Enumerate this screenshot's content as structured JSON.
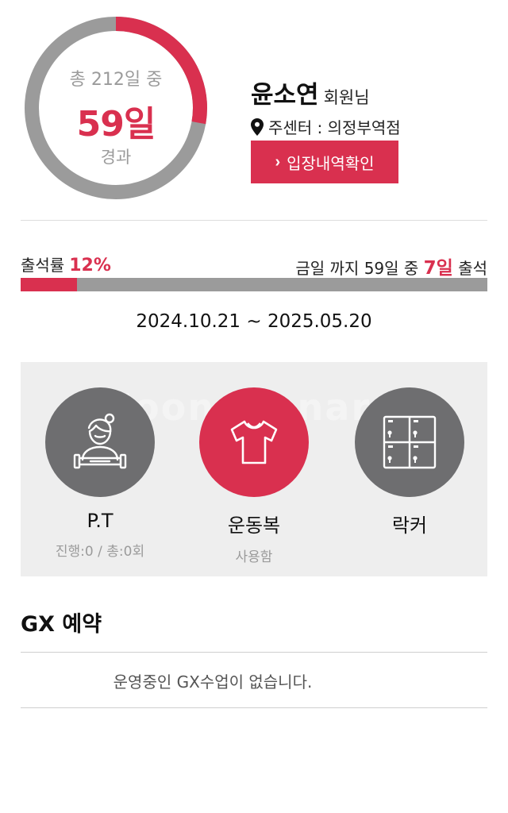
{
  "summary": {
    "total_label": "총 212일 중",
    "days": "59일",
    "passed_label": "경과",
    "elapsed_fraction": 0.278
  },
  "member": {
    "name": "윤소연",
    "suffix": "회원님",
    "center": "주센터 : 의정부역점",
    "entry_button": "입장내역확인"
  },
  "attendance": {
    "rate_label": "출석률",
    "rate_value": "12%",
    "rate_fraction": 0.12,
    "prefix": "금일 까지 59일 중",
    "count": "7일",
    "suffix": "출석"
  },
  "period": "2024.10.21 ~ 2025.05.20",
  "services": [
    {
      "label": "P.T",
      "sub": "진행:0 / 총:0회",
      "icon": "trainer-icon",
      "active": false
    },
    {
      "label": "운동복",
      "sub": "사용함",
      "icon": "shirt-icon",
      "active": true
    },
    {
      "label": "락커",
      "sub": "",
      "icon": "locker-icon",
      "active": false
    }
  ],
  "watermark": "Joonggonara",
  "gx": {
    "title": "GX 예약",
    "empty": "운영중인 GX수업이 없습니다."
  },
  "colors": {
    "accent": "#d9304f",
    "gray": "#9b9b9b",
    "dark_circle": "#6e6e70"
  }
}
